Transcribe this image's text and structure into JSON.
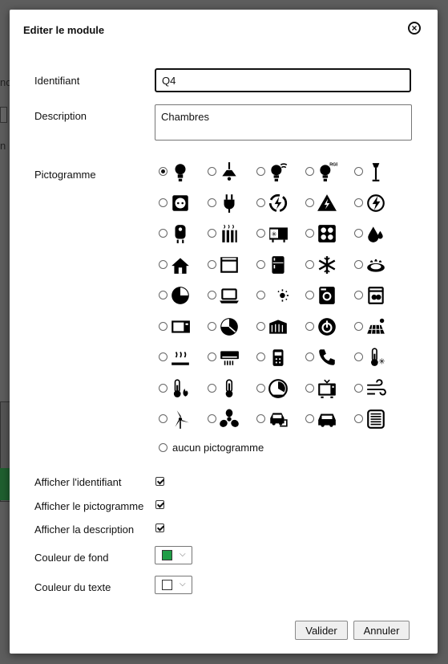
{
  "background": {
    "frag1": "no",
    "frag2": "n"
  },
  "dialog": {
    "title": "Editer le module",
    "fields": {
      "identifiant_label": "Identifiant",
      "identifiant_value": "Q4",
      "description_label": "Description",
      "description_value": "Chambres",
      "pictogramme_label": "Pictogramme"
    },
    "pictogrammes": {
      "selected": "bulb",
      "icons": [
        "bulb",
        "ceiling-lamp",
        "wifi-bulb",
        "rgb-bulb",
        "street-lamp",
        "power-outlet",
        "plug",
        "energy-cycle",
        "high-voltage",
        "lightning-circle",
        "water-heater",
        "radiator",
        "convector",
        "cooktop",
        "water-drop",
        "house",
        "oven",
        "fridge",
        "snowflake",
        "gas-burner",
        "pie-gauge",
        "laptop",
        "day-night",
        "washing-machine",
        "dishwasher",
        "microwave",
        "pie-gauge-2",
        "shutters",
        "power-button",
        "solar-panel",
        "heated-floor",
        "air-conditioner",
        "remote-control",
        "phone",
        "thermometer-snow",
        "thermometer-flame",
        "thermometer",
        "timer",
        "tv",
        "wind",
        "wind-turbine",
        "fan",
        "ev-charging",
        "car",
        "grille"
      ],
      "none_label": "aucun pictogramme"
    },
    "options": {
      "show_id_label": "Afficher l'identifiant",
      "show_id": true,
      "show_picto_label": "Afficher le pictogramme",
      "show_picto": true,
      "show_desc_label": "Afficher la description",
      "show_desc": true
    },
    "colors": {
      "bg_label": "Couleur de fond",
      "bg_value": "#1f9d46",
      "text_label": "Couleur du texte",
      "text_value": "#ffffff"
    },
    "buttons": {
      "ok": "Valider",
      "cancel": "Annuler"
    }
  }
}
